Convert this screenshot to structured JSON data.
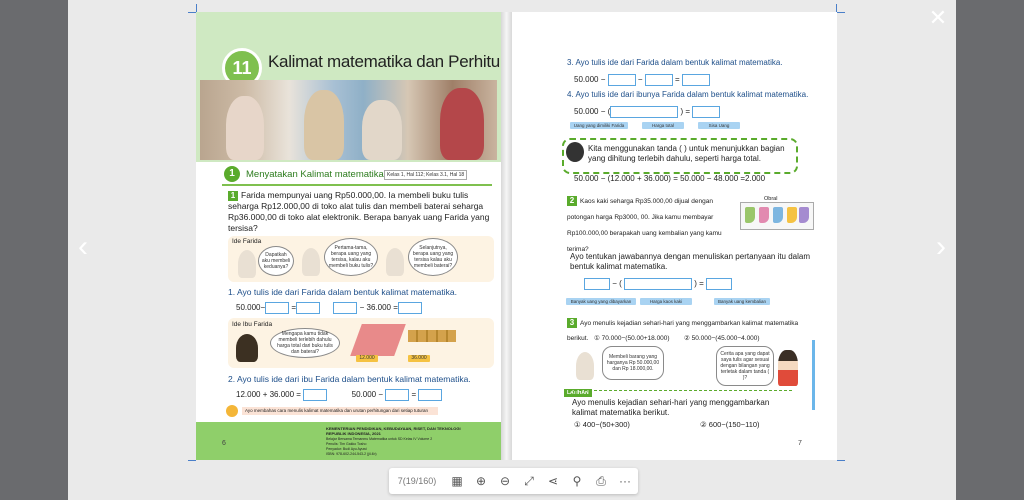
{
  "viewer": {
    "counter": "7(19/160)",
    "prev_icon": "chevron-left-icon",
    "next_icon": "chevron-right-icon",
    "close_icon": "close-icon"
  },
  "toolbar": {
    "icons": [
      "grid-icon",
      "zoom-in-icon",
      "zoom-out-icon",
      "fullscreen-icon",
      "share-icon",
      "search-icon",
      "print-icon",
      "more-icon"
    ]
  },
  "left_page": {
    "chapter_number": "11",
    "chapter_title": "Kalimat matematika dan Perhitungan",
    "section_number": "1",
    "section_title": "Menyatakan Kalimat matematika",
    "section_ref": "Kelas 1, Hal 112; Kelas 3.1, Hal 18",
    "q1_num": "1",
    "q1_text": "Farida mempunyai uang Rp50.000,00. Ia membeli buku tulis seharga Rp12.000,00 di toko alat tulis dan membeli baterai seharga Rp36.000,00 di toko alat elektronik. Berapa banyak uang Farida yang tersisa?",
    "idea_farida_label": "Ide Farida",
    "bubble_1": "Dapatkah aku membeli keduanya?",
    "bubble_2": "Pertama-tama, berapa uang yang tersisa, kalau aku membeli buku tulis?",
    "bubble_3": "Selanjutnya, berapa uang yang tersisa kalau aku membeli baterai?",
    "step1": "1. Ayo tulis ide dari Farida dalam bentuk kalimat matematika.",
    "eq1_a": "50.000−",
    "eq1_b": "=",
    "eq1_c": "− 36.000 =",
    "idea_ibu_label": "Ide Ibu Farida",
    "bubble_ibu": "Mengapa kamu tidak membeli terlebih dahulu harga total dari buku tulis dan baterai?",
    "tag_12000": "12.000",
    "tag_36000": "36.000",
    "step2": "2. Ayo tulis ide dari ibu Farida dalam bentuk kalimat matematika.",
    "eq2_a": "12.000 + 36.000 =",
    "eq2_b": "50.000 −",
    "eq2_c": "=",
    "note": "Ayo membahas cara menulis kalimat matematika dan urutan perhitungan dari setiap tuturan",
    "footer_org": "KEMENTERIAN PENDIDIKAN, KEBUDAYAAN, RISET, DAN TEKNOLOGI REPUBLIK INDONESIA, 2021",
    "footer_line2": "Belajar Bersama Temanmu Matematika untuk SD Kelas IV Volume 2",
    "footer_line3": "Penulis: Tim Gakko Tosho",
    "footer_line4": "Penyadur: Budi Ayu Ayuwi",
    "footer_line5": "ISBN: 978-602-244-543-2 (jil.4b)",
    "page_number": "6"
  },
  "right_page": {
    "step3": "3. Ayo tulis ide dari Farida dalam bentuk kalimat matematika.",
    "eq3_a": "50.000 −",
    "eq3_b": "−",
    "eq3_c": "=",
    "step4": "4. Ayo tulis ide dari ibunya Farida dalam bentuk kalimat matematika.",
    "eq4_a": "50.000 − (",
    "eq4_b": ") =",
    "tag_uang": "Uang yang dimiliki Farida",
    "tag_harga": "Harga total",
    "tag_sisa": "Sisa Uang",
    "info_text": "Kita menggunakan tanda (  ) untuk menunjukkan bagian yang dihitung terlebih dahulu, seperti harga total.",
    "calc": "50.000 − (12.000 + 36.000) = 50.000 − 48.000 =2.000",
    "q2_num": "2",
    "q2_text": "Kaos kaki seharga Rp35.000,00 dijual dengan potongan harga Rp3000, 00. Jika kamu membayar Rp100.000,00 berapakah uang kembalian yang kamu terima?",
    "obral": "Obral",
    "q2_instruction": "Ayo tentukan jawabannya dengan menuliskan pertanyaan itu dalam bentuk kalimat matematika.",
    "eq5_a": "−  (",
    "eq5_b": ")  =",
    "tag_dibayar": "Banyak uang yang dibayarkan",
    "tag_kaos": "Harga kaos kaki",
    "tag_kembali": "Banyak uang kembalian",
    "q3_num": "3",
    "q3_text": "Ayo menulis kejadian sehari-hari yang menggambarkan  kalimat matematika",
    "q3_berikut": "berikut.",
    "q3_opt1": "① 70.000−(50.00+18.000)",
    "q3_opt2": "② 50.000−(45.000−4.000)",
    "bubble_r1": "Membeli barang yang harganya Rp 50.000,00 dan Rp 18.000,00.",
    "bubble_r2": "Cerita apa yang dapat saya tulis agar sesuai dengan bilangan yang terletak dalam tanda ( )?",
    "latihan": "LATIHAN",
    "latihan_text": "Ayo menulis kejadian sehari-hari yang menggambarkan kalimat matematika berikut.",
    "latihan_opt1": "① 400−(50+300)",
    "latihan_opt2": "② 600−(150−110)",
    "page_number": "7"
  },
  "colors": {
    "green": "#5aab2c",
    "light_green": "#cfe9c2",
    "blue_box": "#5aa6e0",
    "tag_blue": "#a9d3f2"
  }
}
